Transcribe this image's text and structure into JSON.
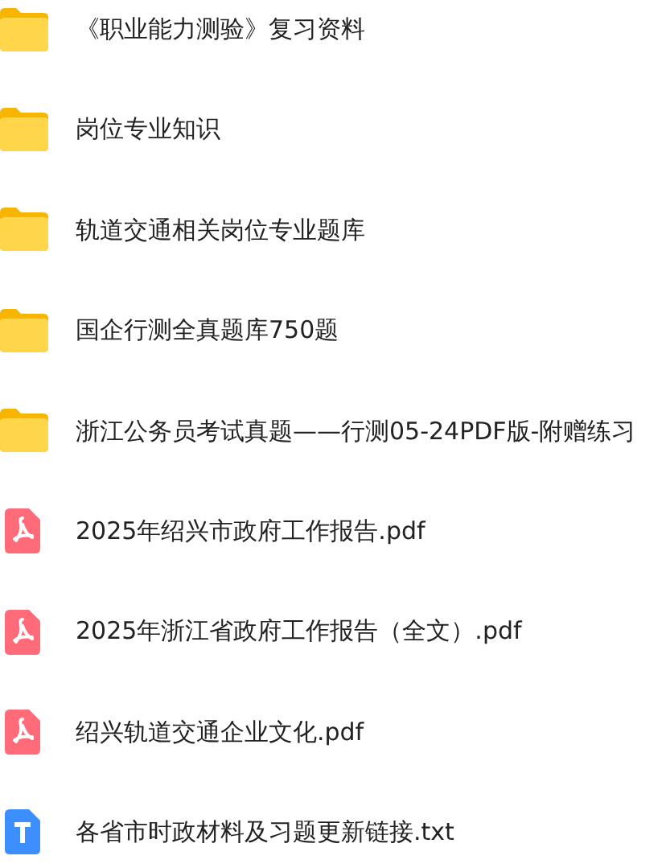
{
  "files": [
    {
      "kind": "folder",
      "name": "《职业能力测验》复习资料"
    },
    {
      "kind": "folder",
      "name": "岗位专业知识"
    },
    {
      "kind": "folder",
      "name": "轨道交通相关岗位专业题库"
    },
    {
      "kind": "folder",
      "name": "国企行测全真题库750题"
    },
    {
      "kind": "folder",
      "name": "浙江公务员考试真题——行测05-24PDF版-附赠练习"
    },
    {
      "kind": "pdf",
      "name": "2025年绍兴市政府工作报告.pdf"
    },
    {
      "kind": "pdf",
      "name": "2025年浙江省政府工作报告（全文）.pdf"
    },
    {
      "kind": "pdf",
      "name": "绍兴轨道交通企业文化.pdf"
    },
    {
      "kind": "txt",
      "name": "各省市时政材料及习题更新链接.txt"
    }
  ]
}
